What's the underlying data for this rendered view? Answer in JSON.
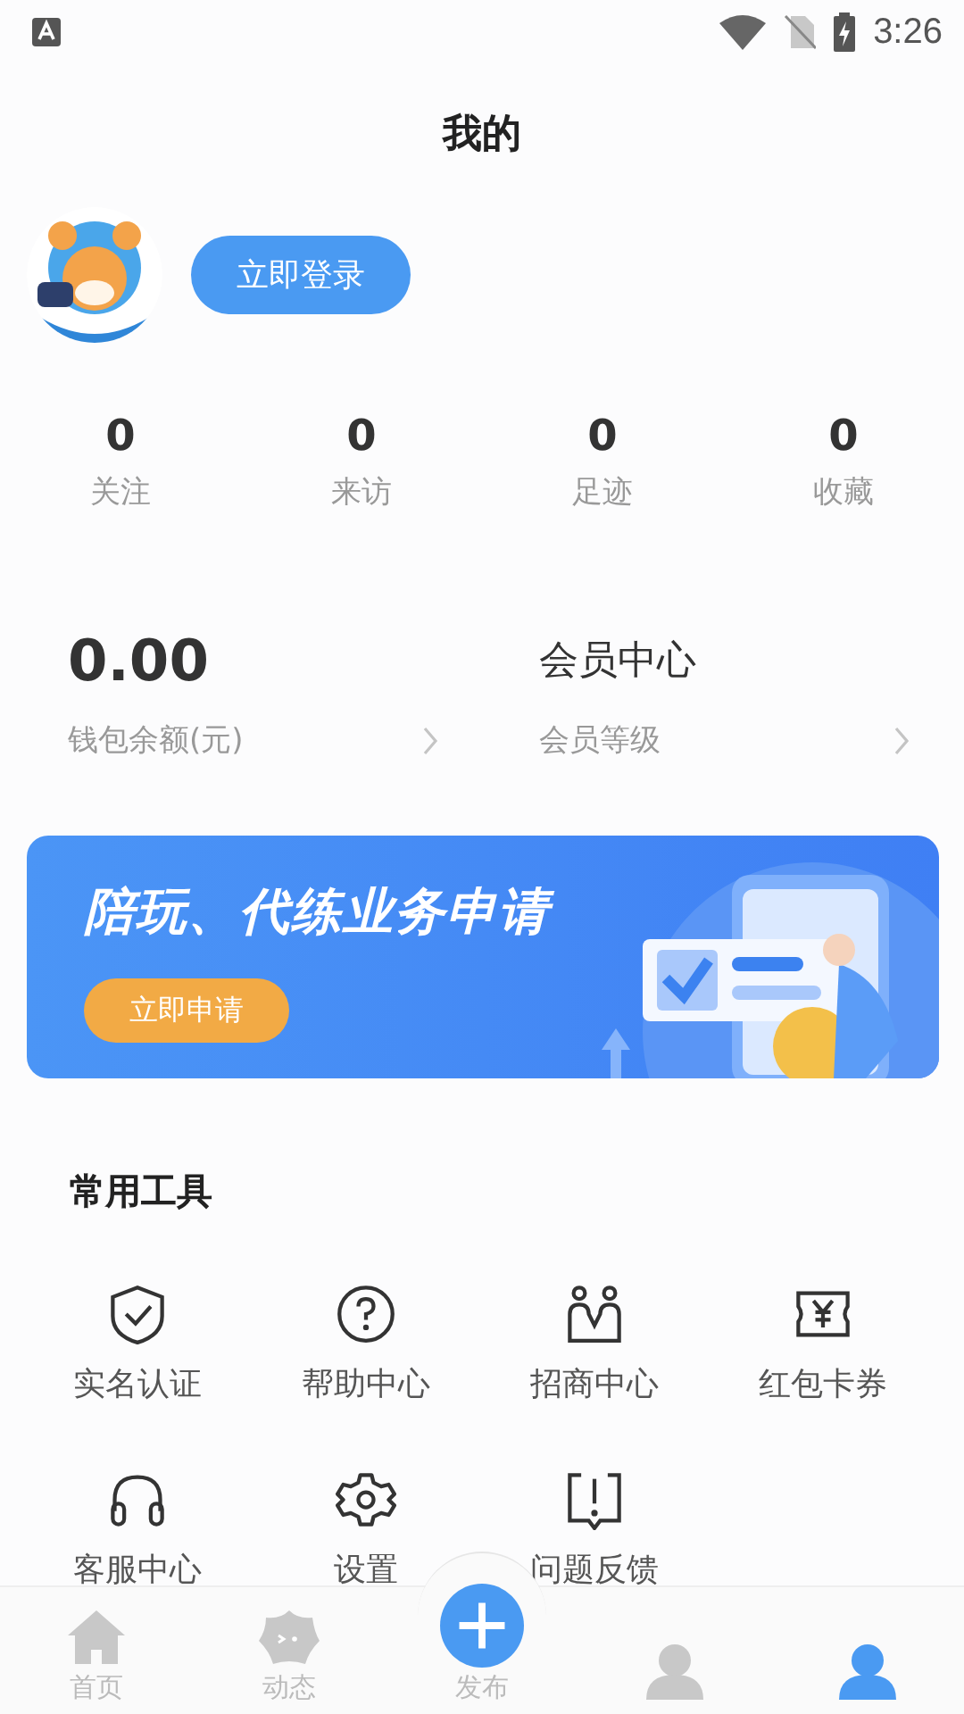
{
  "status_bar": {
    "time": "3:26"
  },
  "header": {
    "title": "我的"
  },
  "profile": {
    "login_button": "立即登录"
  },
  "stats": [
    {
      "value": "0",
      "label": "关注"
    },
    {
      "value": "0",
      "label": "来访"
    },
    {
      "value": "0",
      "label": "足迹"
    },
    {
      "value": "0",
      "label": "收藏"
    }
  ],
  "wallet": {
    "value": "0.00",
    "label": "钱包余额(元)"
  },
  "membership": {
    "title": "会员中心",
    "label": "会员等级"
  },
  "banner": {
    "title": "陪玩、代练业务申请",
    "button": "立即申请"
  },
  "tools": {
    "title": "常用工具",
    "items": [
      {
        "label": "实名认证"
      },
      {
        "label": "帮助中心"
      },
      {
        "label": "招商中心"
      },
      {
        "label": "红包卡券"
      },
      {
        "label": "客服中心"
      },
      {
        "label": "设置"
      },
      {
        "label": "问题反馈"
      }
    ]
  },
  "nav": [
    {
      "label": "首页",
      "selected": false
    },
    {
      "label": "动态",
      "selected": false
    },
    {
      "label": "发布",
      "selected": false
    },
    {
      "selected": false
    },
    {
      "selected": true
    }
  ]
}
